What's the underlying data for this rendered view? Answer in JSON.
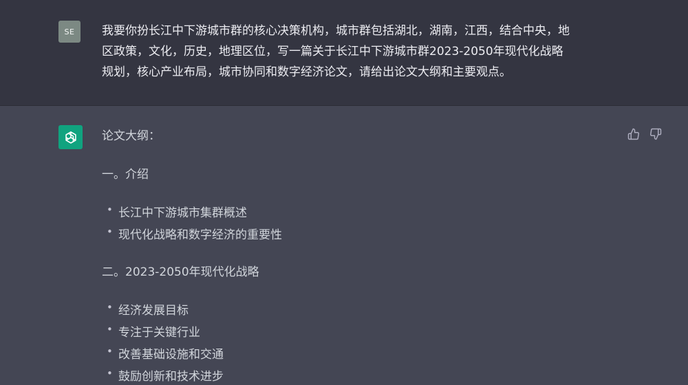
{
  "user_message": {
    "avatar_initials": "SE",
    "text": "我要你扮长江中下游城市群的核心决策机构，城市群包括湖北，湖南，江西，结合中央，地\n区政策，文化，历史，地理区位，写一篇关于长江中下游城市群2023-2050年现代化战略\n规划，核心产业布局，城市协同和数字经济论文，请给出论文大纲和主要观点。"
  },
  "assistant_message": {
    "avatar_icon": "openai-logo-icon",
    "intro": "论文大纲：",
    "sections": [
      {
        "heading": "一。介绍",
        "bullets": [
          "长江中下游城市集群概述",
          "现代化战略和数字经济的重要性"
        ]
      },
      {
        "heading": "二。2023-2050年现代化战略",
        "bullets": [
          "经济发展目标",
          "专注于关键行业",
          "改善基础设施和交通",
          "鼓励创新和技术进步"
        ]
      }
    ],
    "bullet_glyph": "•",
    "feedback": {
      "thumbs_up_icon": "thumbs-up-icon",
      "thumbs_down_icon": "thumbs-down-icon"
    }
  },
  "colors": {
    "user_bg": "#343541",
    "assistant_bg": "#444654",
    "user_avatar_bg": "#7c8983",
    "bot_avatar_bg": "#10a37f",
    "text": "#ececf1",
    "assistant_text": "#d1d5db"
  }
}
